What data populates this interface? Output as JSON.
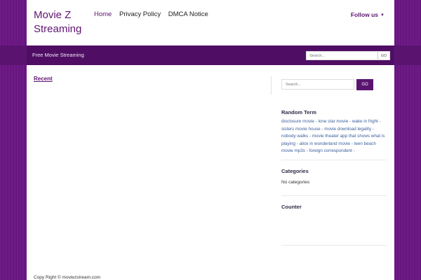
{
  "header": {
    "site_title": "Movie Z Streaming",
    "nav": [
      "Home",
      "Privacy Policy",
      "DMCA Notice"
    ],
    "follow_label": "Follow us",
    "caret": "▼"
  },
  "subbar": {
    "tagline": "Free Movie Streaming",
    "search": {
      "placeholder": "Search...",
      "button": "GO"
    }
  },
  "main": {
    "recent_label": "Recent"
  },
  "sidebar": {
    "search": {
      "placeholder": "Search...",
      "button": "GO"
    },
    "random_term": {
      "title": "Random Term",
      "terms": [
        "disclosure movie",
        "lone star movie",
        "wake in fright",
        "sisters movie house",
        "movie download legality",
        "nobody walks",
        "movie theater app that shows what is playing",
        "alice in wonderland movie",
        "teen beach movie mp3s",
        "foreign correspondent"
      ],
      "separator": " - "
    },
    "categories": {
      "title": "Categories",
      "text": "No categories"
    },
    "counter": {
      "title": "Counter"
    }
  },
  "footer": {
    "text": "Copy Right © moviezstream.com"
  },
  "colors": {
    "brand_purple": "#5a1470",
    "background_purple": "#6d1a84",
    "link_blue": "#3a5e9c"
  }
}
